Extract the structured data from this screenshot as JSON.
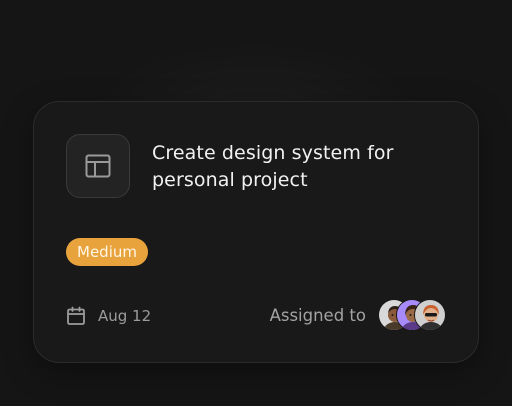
{
  "task": {
    "title": "Create design system for personal project",
    "priority": "Medium",
    "due_date": "Aug 12",
    "assignee_label": "Assigned to",
    "icon": "layout-icon"
  },
  "avatars": [
    {
      "name": "assignee-avatar-1",
      "bg": "#d9d9d9"
    },
    {
      "name": "assignee-avatar-2",
      "bg": "#a78bfa"
    },
    {
      "name": "assignee-avatar-3",
      "bg": "#cfcfcf"
    }
  ],
  "colors": {
    "background": "#151515",
    "card": "#191919",
    "badge": "#e8a33c"
  }
}
